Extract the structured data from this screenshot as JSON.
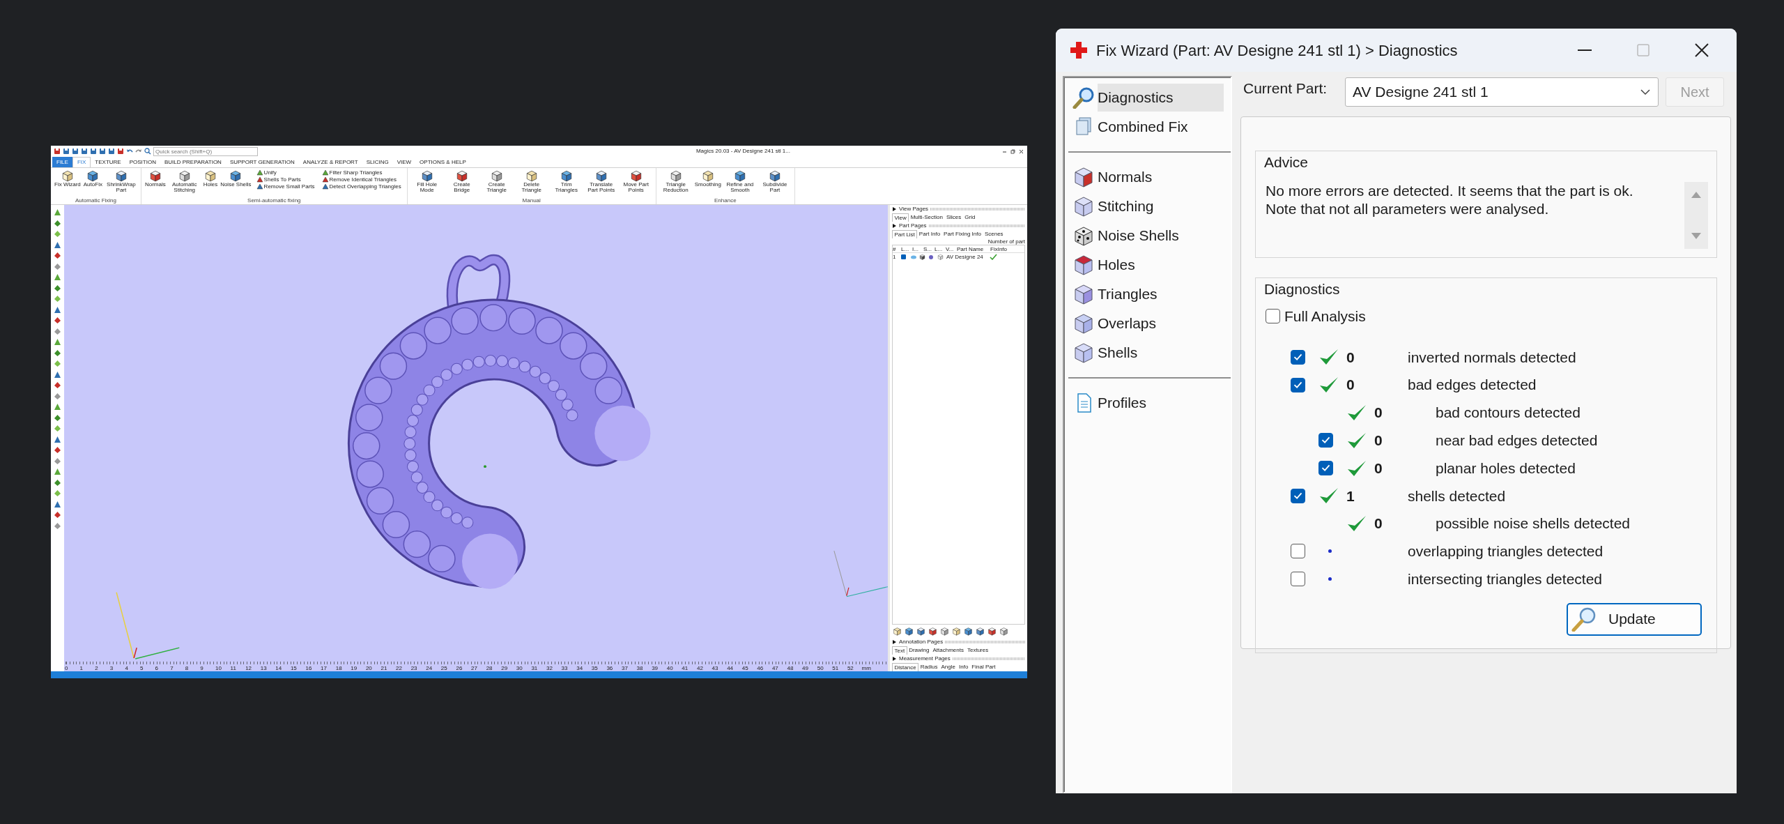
{
  "magics": {
    "title": "Magics 20.03 - AV Designe 241 stl 1...",
    "quick_search": {
      "placeholder": "Quick search (Shift+Q)"
    },
    "tabs": [
      {
        "label": "FILE",
        "kind": "file",
        "selected": false
      },
      {
        "label": "FIX",
        "kind": "tab",
        "selected": true
      },
      {
        "label": "TEXTURE",
        "kind": "tab",
        "selected": false
      },
      {
        "label": "POSITION",
        "kind": "tab",
        "selected": false
      },
      {
        "label": "BUILD PREPARATION",
        "kind": "tab",
        "selected": false
      },
      {
        "label": "SUPPORT GENERATION",
        "kind": "tab",
        "selected": false
      },
      {
        "label": "ANALYZE & REPORT",
        "kind": "tab",
        "selected": false
      },
      {
        "label": "SLICING",
        "kind": "tab",
        "selected": false
      },
      {
        "label": "VIEW",
        "kind": "tab",
        "selected": false
      },
      {
        "label": "OPTIONS & HELP",
        "kind": "tab",
        "selected": false
      }
    ],
    "ribbon_groups": [
      {
        "label": "Automatic Fixing",
        "items": [
          {
            "label": "Fix Wizard",
            "kind": "large"
          },
          {
            "label": "AutoFix",
            "kind": "large"
          },
          {
            "label": "ShrinkWrap Part",
            "kind": "large"
          }
        ]
      },
      {
        "label": "Semi-automatic fixing",
        "items": [
          {
            "label": "Normals",
            "kind": "large"
          },
          {
            "label": "Automatic Stitching",
            "kind": "large"
          },
          {
            "label": "Holes",
            "kind": "large"
          },
          {
            "label": "Noise Shells",
            "kind": "large"
          },
          {
            "label": "Unify",
            "kind": "small"
          },
          {
            "label": "Shells To Parts",
            "kind": "small"
          },
          {
            "label": "Remove Small Parts",
            "kind": "small"
          },
          {
            "label": "Filter Sharp Triangles",
            "kind": "small"
          },
          {
            "label": "Remove Identical Triangles",
            "kind": "small"
          },
          {
            "label": "Detect Overlapping Triangles",
            "kind": "small"
          }
        ]
      },
      {
        "label": "Manual",
        "items": [
          {
            "label": "Fill Hole Mode",
            "kind": "large"
          },
          {
            "label": "Create Bridge",
            "kind": "large"
          },
          {
            "label": "Create Triangle",
            "kind": "large"
          },
          {
            "label": "Delete Triangle",
            "kind": "large"
          },
          {
            "label": "Trim Triangles",
            "kind": "large"
          },
          {
            "label": "Translate Part Points",
            "kind": "large"
          },
          {
            "label": "Move Part Points",
            "kind": "large"
          }
        ]
      },
      {
        "label": "Enhance",
        "items": [
          {
            "label": "Triangle Reduction",
            "kind": "large"
          },
          {
            "label": "Smoothing",
            "kind": "large"
          },
          {
            "label": "Refine and Smooth",
            "kind": "large"
          },
          {
            "label": "Subdivide Part",
            "kind": "large"
          }
        ]
      }
    ],
    "view_pages": {
      "title": "View Pages",
      "tabs": [
        {
          "label": "View",
          "selected": true
        },
        {
          "label": "Multi-Section",
          "selected": false
        },
        {
          "label": "Slices",
          "selected": false
        },
        {
          "label": "Grid",
          "selected": false
        }
      ]
    },
    "part_pages": {
      "title": "Part Pages",
      "tabs": [
        {
          "label": "Part List",
          "selected": true
        },
        {
          "label": "Part Info",
          "selected": false
        },
        {
          "label": "Part Fixing Info",
          "selected": false
        },
        {
          "label": "Scenes",
          "selected": false
        }
      ],
      "note": "Number of part",
      "columns": [
        "#",
        "L...",
        "I...",
        "S...",
        "L...",
        "V...",
        "Part Name",
        "FixInfo"
      ],
      "rows": [
        {
          "number": "1",
          "checked": true,
          "name": "AV Designe 24",
          "fixed": true
        }
      ]
    },
    "annotation_pages": {
      "title": "Annotation Pages",
      "tabs": [
        {
          "label": "Text",
          "selected": true
        },
        {
          "label": "Drawing",
          "selected": false
        },
        {
          "label": "Attachments",
          "selected": false
        },
        {
          "label": "Textures",
          "selected": false
        }
      ]
    },
    "measurement_pages": {
      "title": "Measurement Pages",
      "tabs": [
        {
          "label": "Distance",
          "selected": true
        },
        {
          "label": "Radius",
          "selected": false
        },
        {
          "label": "Angle",
          "selected": false
        },
        {
          "label": "Info",
          "selected": false
        },
        {
          "label": "Final Part",
          "selected": false
        }
      ]
    },
    "ruler": {
      "ticks": [
        "0",
        "1",
        "2",
        "3",
        "4",
        "5",
        "6",
        "7",
        "8",
        "9",
        "10",
        "11",
        "12",
        "13",
        "14",
        "15",
        "16",
        "17",
        "18",
        "19",
        "20",
        "21",
        "22",
        "23",
        "24",
        "25",
        "26",
        "27",
        "28",
        "29",
        "30",
        "31",
        "32",
        "33",
        "34",
        "35",
        "36",
        "37",
        "38",
        "39",
        "40",
        "41",
        "42",
        "43",
        "44",
        "45",
        "46",
        "47",
        "48",
        "49",
        "50",
        "51",
        "52"
      ],
      "unit": "mm"
    }
  },
  "fix_wizard": {
    "title": "Fix Wizard (Part: AV Designe 241 stl 1) > Diagnostics",
    "nav_sections": [
      [
        {
          "label": "Diagnostics",
          "selected": true
        },
        {
          "label": "Combined Fix",
          "selected": false
        }
      ],
      [
        {
          "label": "Normals",
          "selected": false
        },
        {
          "label": "Stitching",
          "selected": false
        },
        {
          "label": "Noise Shells",
          "selected": false
        },
        {
          "label": "Holes",
          "selected": false
        },
        {
          "label": "Triangles",
          "selected": false
        },
        {
          "label": "Overlaps",
          "selected": false
        },
        {
          "label": "Shells",
          "selected": false
        }
      ],
      [
        {
          "label": "Profiles",
          "selected": false
        }
      ]
    ],
    "current_part": {
      "label": "Current Part:",
      "value": "AV Designe 241 stl 1"
    },
    "next_button": {
      "label": "Next",
      "disabled": true
    },
    "advice": {
      "title": "Advice",
      "lines": [
        "No more errors are detected. It seems that the part is ok.",
        "Note that not all parameters were analysed."
      ]
    },
    "diagnostics": {
      "title": "Diagnostics",
      "full_analysis": {
        "label": "Full Analysis",
        "checked": false
      },
      "rows": [
        {
          "kind": "checkbox",
          "checked": true,
          "ok": true,
          "count": "0",
          "label": "inverted normals detected"
        },
        {
          "kind": "checkbox",
          "checked": true,
          "ok": true,
          "count": "0",
          "label": "bad edges detected",
          "children": [
            {
              "kind": "plain",
              "ok": true,
              "count": "0",
              "label": "bad contours detected"
            },
            {
              "kind": "checkbox",
              "checked": true,
              "ok": true,
              "count": "0",
              "label": "near bad edges detected"
            },
            {
              "kind": "checkbox",
              "checked": true,
              "ok": true,
              "count": "0",
              "label": "planar holes detected"
            }
          ]
        },
        {
          "kind": "checkbox",
          "checked": true,
          "ok": true,
          "count": "1",
          "label": "shells detected",
          "children": [
            {
              "kind": "plain",
              "ok": true,
              "count": "0",
              "label": "possible noise shells detected"
            }
          ]
        },
        {
          "kind": "checkbox",
          "checked": false,
          "ok": false,
          "label": "overlapping triangles detected"
        },
        {
          "kind": "checkbox",
          "checked": false,
          "ok": false,
          "label": "intersecting triangles detected"
        }
      ]
    },
    "update_button": {
      "label": "Update"
    }
  }
}
